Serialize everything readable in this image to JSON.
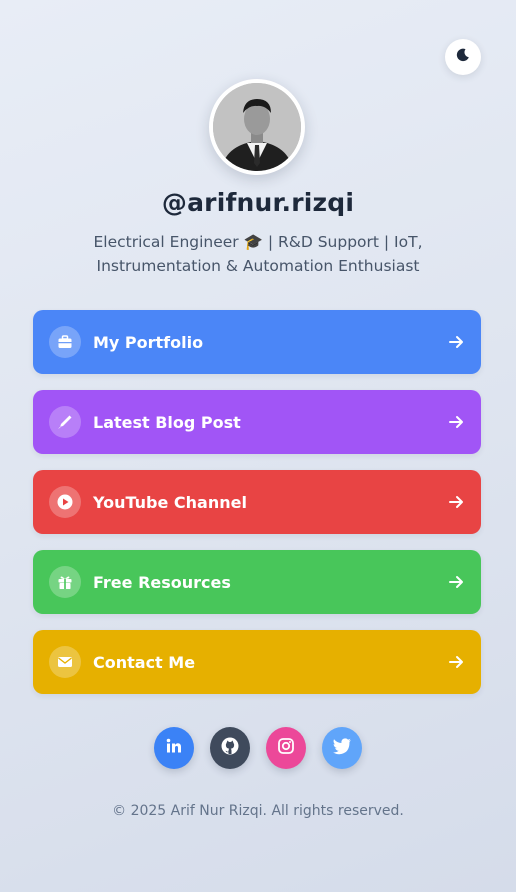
{
  "profile": {
    "username": "@arifnur.rizqi",
    "bio": "Electrical Engineer 🎓 | R&D Support | IoT, Instrumentation & Automation Enthusiast"
  },
  "theme_toggle": {
    "icon": "moon-icon"
  },
  "links": [
    {
      "label": "My Portfolio",
      "icon": "briefcase-icon",
      "color": "#4b86f7"
    },
    {
      "label": "Latest Blog Post",
      "icon": "pen-icon",
      "color": "#a155f6"
    },
    {
      "label": "YouTube Channel",
      "icon": "play-icon",
      "color": "#e84444"
    },
    {
      "label": "Free Resources",
      "icon": "gift-icon",
      "color": "#48c65a"
    },
    {
      "label": "Contact Me",
      "icon": "envelope-icon",
      "color": "#e6b000"
    }
  ],
  "socials": [
    {
      "name": "linkedin",
      "icon": "linkedin-icon",
      "color": "#3b82f6"
    },
    {
      "name": "github",
      "icon": "github-icon",
      "color": "#3f4a5c"
    },
    {
      "name": "instagram",
      "icon": "instagram-icon",
      "color": "#ec4899"
    },
    {
      "name": "twitter",
      "icon": "twitter-icon",
      "color": "#60a5fa"
    }
  ],
  "footer": {
    "text": "© 2025 Arif Nur Rizqi. All rights reserved."
  }
}
